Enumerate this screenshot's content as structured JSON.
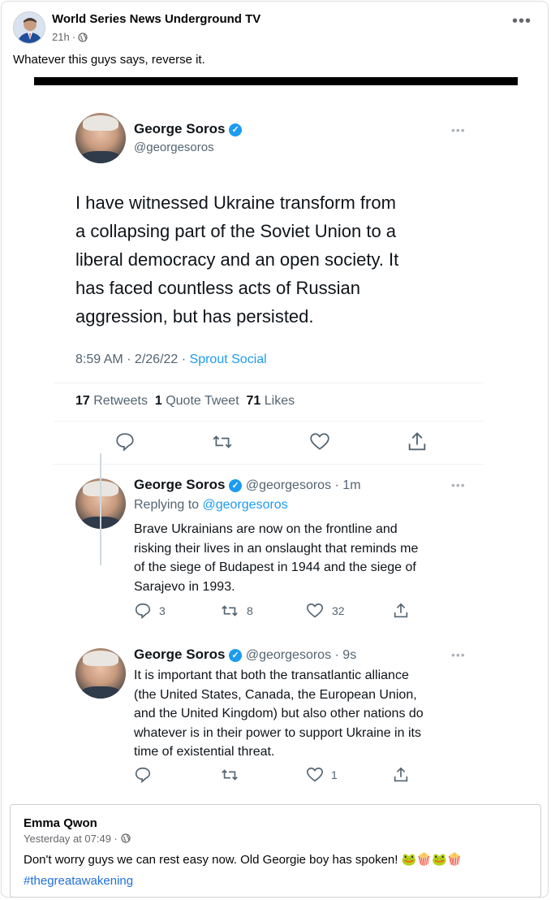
{
  "post": {
    "author": "World Series News Underground TV",
    "time": "21h",
    "text": "Whatever this guys says, reverse it."
  },
  "tweet_main": {
    "name": "George Soros",
    "handle": "@georgesoros",
    "body_lines": [
      "I have witnessed Ukraine transform from",
      "a collapsing part of the Soviet Union to a",
      "liberal democracy and an open society. It",
      "has faced countless acts of Russian",
      "aggression, but has persisted."
    ],
    "timestamp": "8:59 AM · 2/26/22 · ",
    "source": "Sprout Social",
    "retweets_count": "17",
    "retweets_label": "Retweets",
    "quote_count": "1",
    "quote_label": "Quote Tweet",
    "likes_count": "71",
    "likes_label": "Likes"
  },
  "reply1": {
    "name": "George Soros",
    "handle_time": "@georgesoros · 1m",
    "replying_prefix": "Replying to ",
    "replying_handle": "@georgesoros",
    "body_lines": [
      "Brave Ukrainians are now on the frontline and",
      "risking their lives in an onslaught that reminds me",
      "of the siege of Budapest in 1944 and the siege of",
      "Sarajevo in 1993."
    ],
    "replies": "3",
    "retweets": "8",
    "likes": "32"
  },
  "reply2": {
    "name": "George Soros",
    "handle_time": "@georgesoros · 9s",
    "body_lines": [
      "It is important that both the transatlantic alliance",
      "(the United States, Canada, the European Union,",
      "and the United Kingdom) but also other nations do",
      "whatever is in their power to support Ukraine in its",
      "time of existential threat."
    ],
    "likes": "1"
  },
  "comment": {
    "author": "Emma Qwon",
    "time": "Yesterday at 07:49 · ",
    "text": "Don't worry guys we can rest easy now. Old Georgie boy has spoken! 🐸🍿🐸🍿",
    "hashtag": "#thegreatawakening"
  },
  "icons": [
    "globe-icon",
    "more-icon",
    "verified-badge-icon",
    "reply-icon",
    "retweet-icon",
    "like-icon",
    "share-icon"
  ],
  "colors": {
    "link": "#216fdb",
    "twitter_blue": "#1d9bf0",
    "meta_gray": "#65676b"
  }
}
